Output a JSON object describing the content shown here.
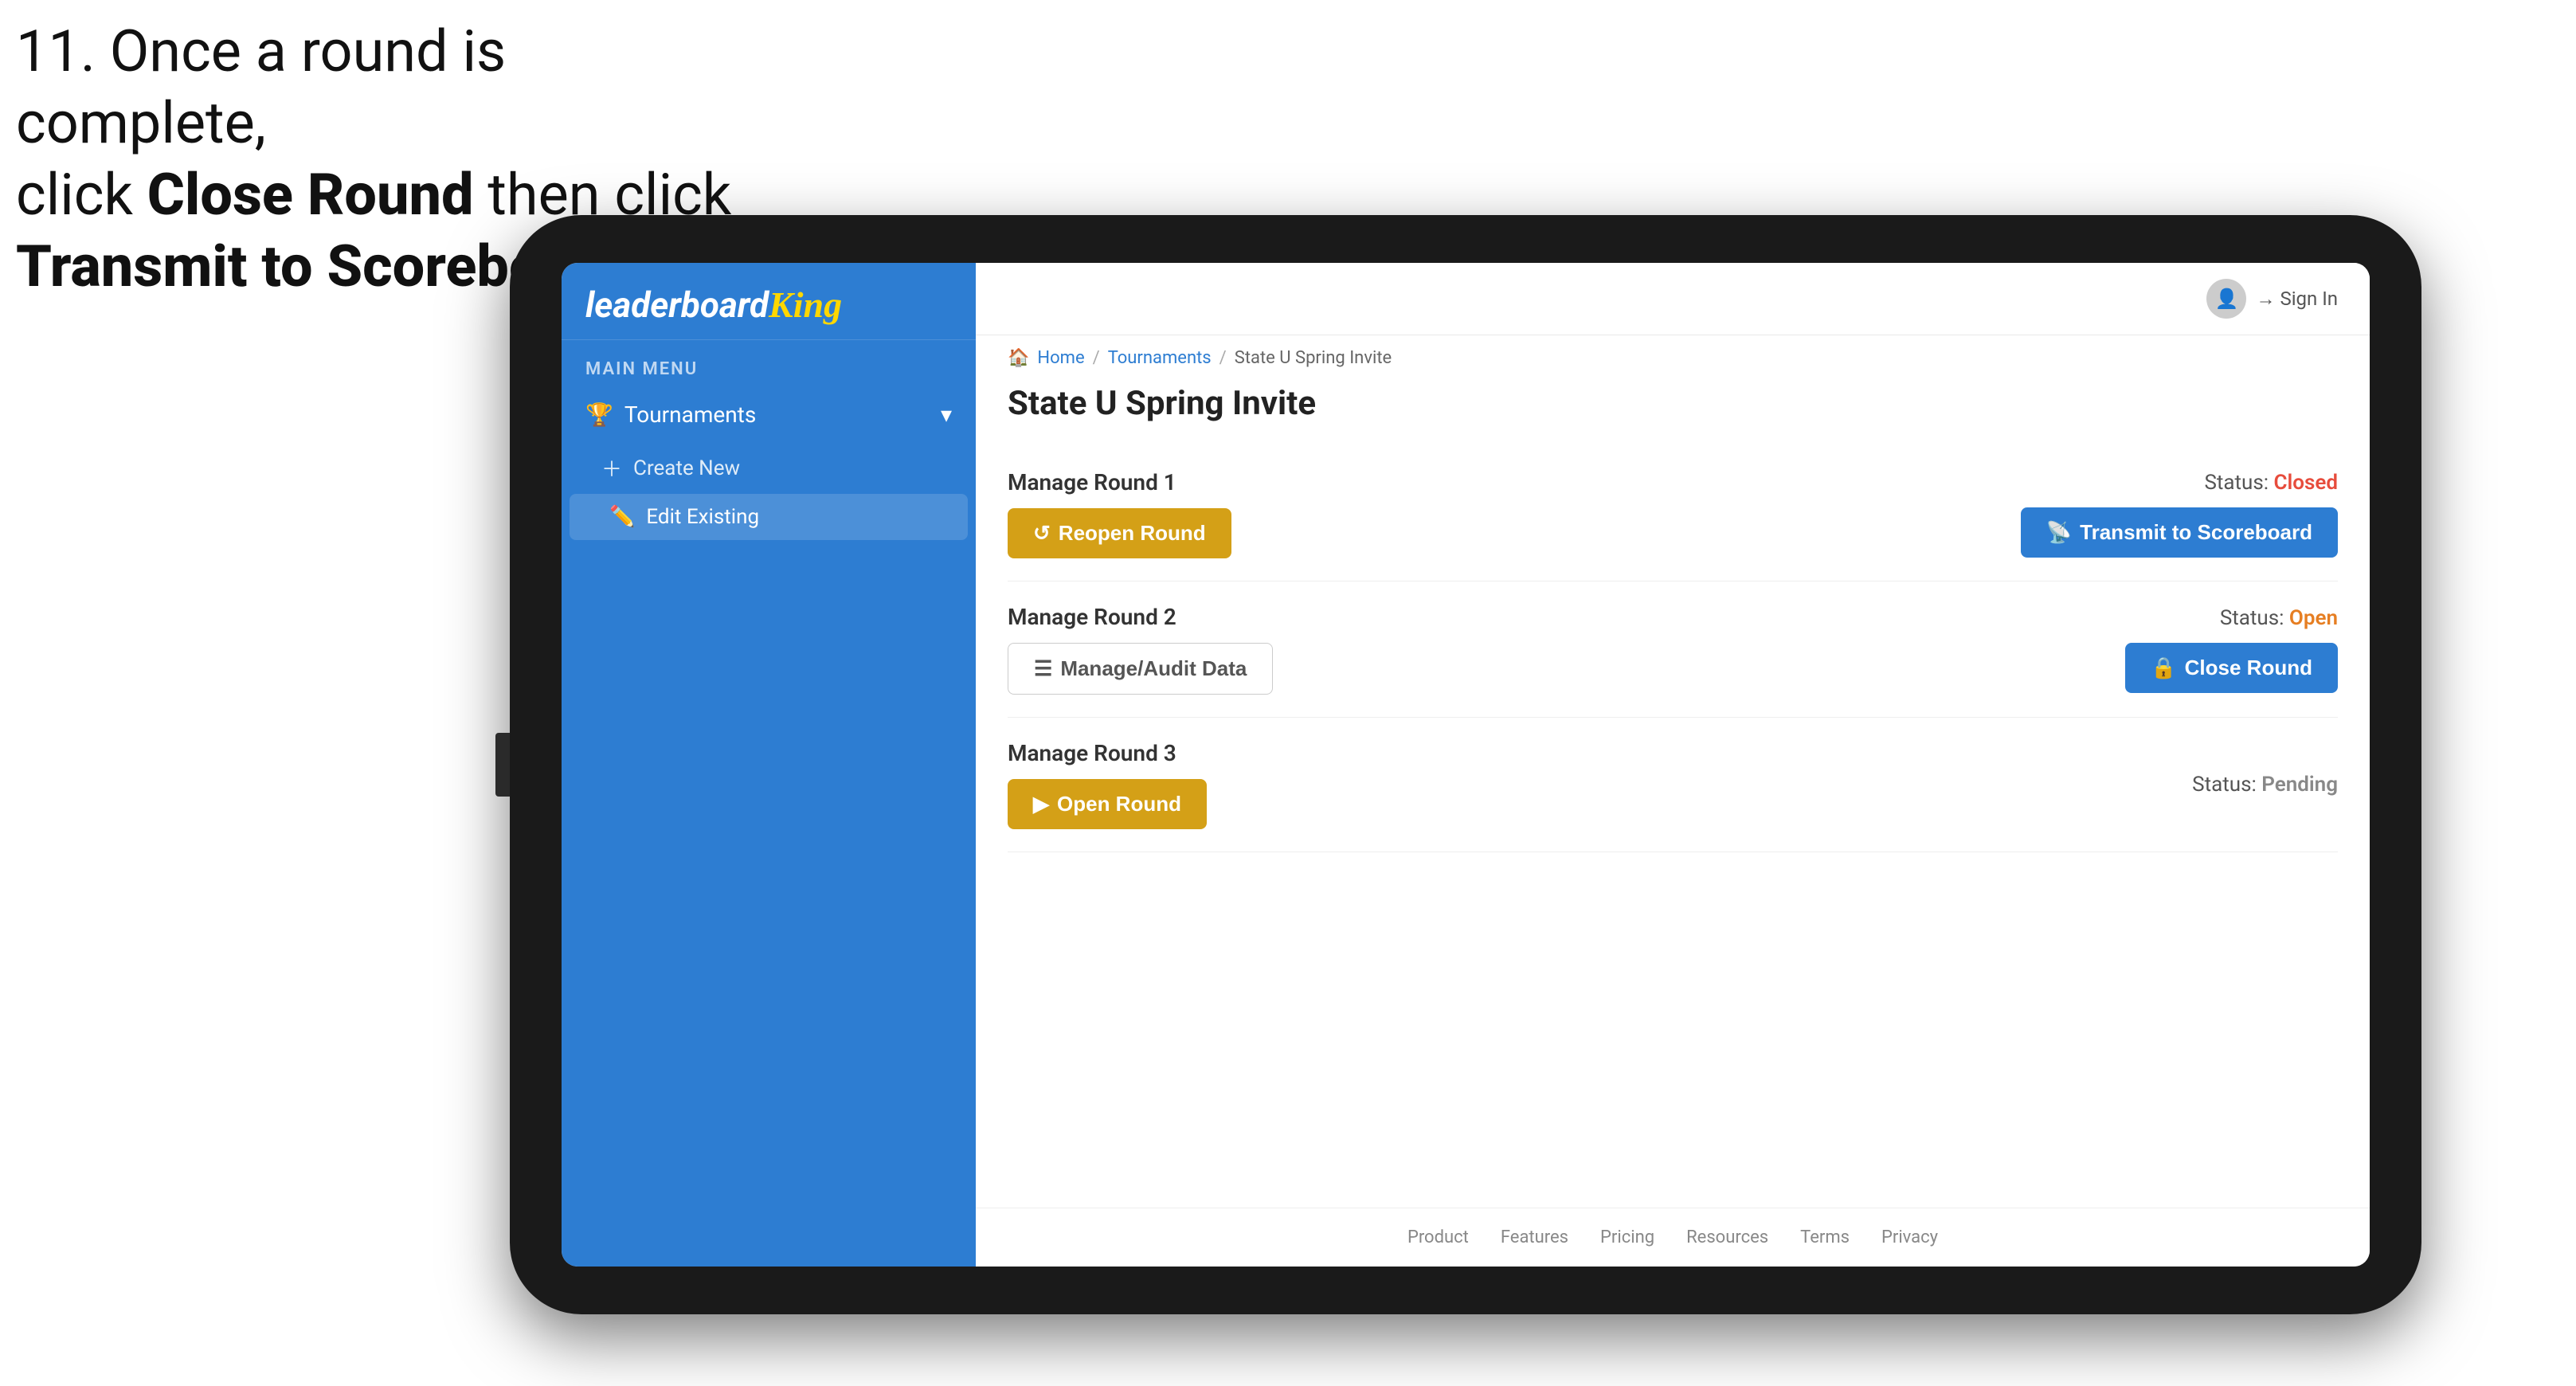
{
  "instruction": {
    "line1": "11. Once a round is complete,",
    "line2_prefix": "click ",
    "line2_bold": "Close Round",
    "line2_suffix": " then click",
    "line3_bold": "Transmit to Scoreboard."
  },
  "sidebar": {
    "logo": "leaderboard",
    "logo_king": "King",
    "menu_label": "MAIN MENU",
    "nav": {
      "tournaments_label": "Tournaments",
      "create_new_label": "Create New",
      "edit_existing_label": "Edit Existing"
    }
  },
  "header": {
    "sign_in_label": "Sign In"
  },
  "breadcrumb": {
    "home": "Home",
    "tournaments": "Tournaments",
    "current": "State U Spring Invite"
  },
  "page": {
    "title": "State U Spring Invite",
    "rounds": [
      {
        "id": "round1",
        "title": "Manage Round 1",
        "status_label": "Status:",
        "status_value": "Closed",
        "status_type": "closed",
        "primary_btn_label": "Reopen Round",
        "secondary_btn_label": "Transmit to Scoreboard"
      },
      {
        "id": "round2",
        "title": "Manage Round 2",
        "status_label": "Status:",
        "status_value": "Open",
        "status_type": "open",
        "primary_btn_label": "Manage/Audit Data",
        "secondary_btn_label": "Close Round"
      },
      {
        "id": "round3",
        "title": "Manage Round 3",
        "status_label": "Status:",
        "status_value": "Pending",
        "status_type": "pending",
        "primary_btn_label": "Open Round"
      }
    ]
  },
  "footer": {
    "links": [
      "Product",
      "Features",
      "Pricing",
      "Resources",
      "Terms",
      "Privacy"
    ]
  }
}
